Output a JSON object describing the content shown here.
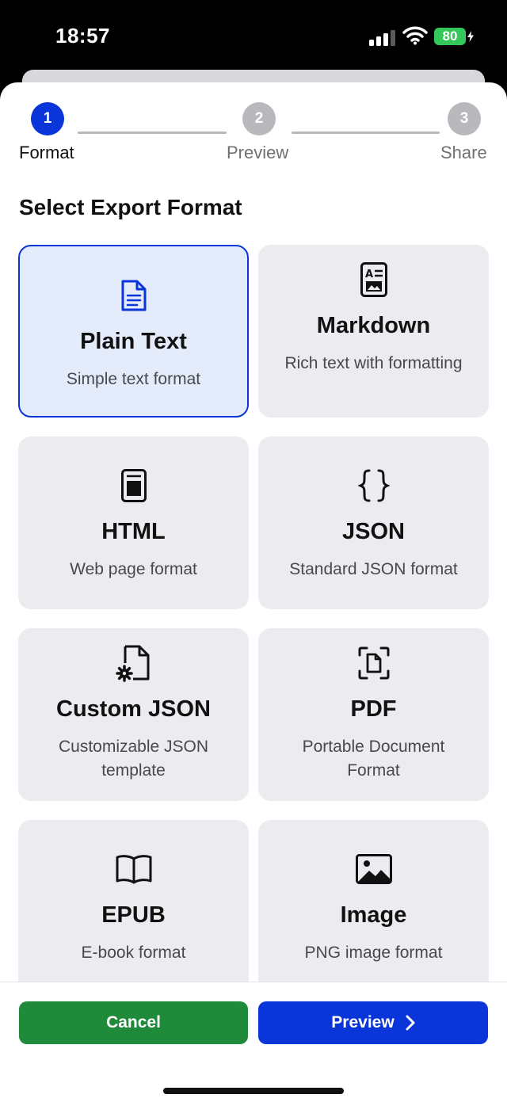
{
  "status_bar": {
    "time": "18:57",
    "battery": "80",
    "colors": {
      "battery": "#34c759"
    }
  },
  "stepper": {
    "steps": [
      {
        "number": "1",
        "label": "Format",
        "state": "active"
      },
      {
        "number": "2",
        "label": "Preview",
        "state": "inactive"
      },
      {
        "number": "3",
        "label": "Share",
        "state": "inactive"
      }
    ]
  },
  "section_title": "Select Export Format",
  "formats": [
    {
      "title": "Plain Text",
      "subtitle": "Simple text format",
      "icon": "document-text-icon",
      "selected": true
    },
    {
      "title": "Markdown",
      "subtitle": "Rich text with formatting",
      "icon": "richtext-document-icon",
      "selected": false
    },
    {
      "title": "HTML",
      "subtitle": "Web page format",
      "icon": "webpage-icon",
      "selected": false
    },
    {
      "title": "JSON",
      "subtitle": "Standard JSON format",
      "icon": "curly-braces-icon",
      "selected": false
    },
    {
      "title": "Custom JSON",
      "subtitle": "Customizable JSON template",
      "icon": "document-gear-icon",
      "selected": false
    },
    {
      "title": "PDF",
      "subtitle": "Portable Document Format",
      "icon": "document-viewfinder-icon",
      "selected": false
    },
    {
      "title": "EPUB",
      "subtitle": "E-book format",
      "icon": "book-icon",
      "selected": false
    },
    {
      "title": "Image",
      "subtitle": "PNG image format",
      "icon": "photo-icon",
      "selected": false
    }
  ],
  "buttons": {
    "cancel_label": "Cancel",
    "preview_label": "Preview"
  },
  "colors": {
    "accent": "#0a35d8",
    "cancel": "#1f8a3a",
    "selected_card_bg": "#e4ebfb",
    "card_bg": "#ececf0"
  }
}
